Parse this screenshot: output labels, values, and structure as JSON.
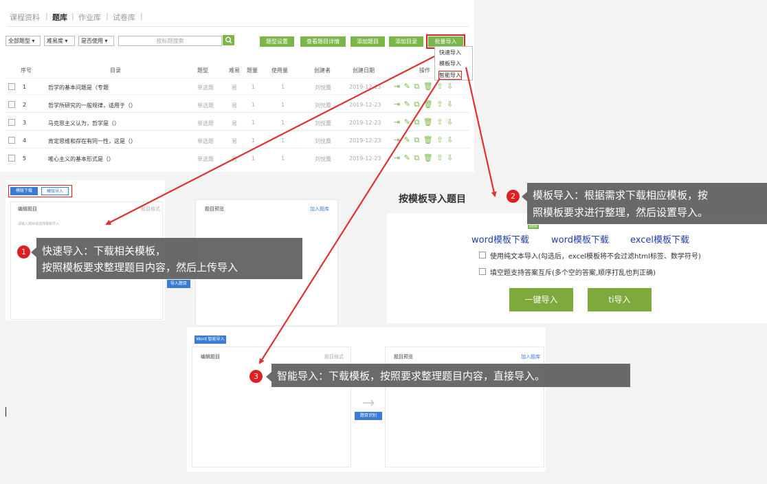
{
  "nav": {
    "tabs": [
      "课程资料",
      "题库",
      "作业库",
      "试卷库"
    ],
    "sep": "|"
  },
  "filters": {
    "type": "全部题型 ▾",
    "difficulty": "难易度 ▾",
    "used": "是否使用 ▾",
    "search_placeholder": "按标题搜索"
  },
  "toolbar": {
    "buttons": [
      "题型设置",
      "查看题目详情",
      "添加题目",
      "添加目录",
      "批量导入"
    ]
  },
  "dropdown": [
    "快速导入",
    "模板导入",
    "智能导入"
  ],
  "table": {
    "headers": [
      "序号",
      "目录",
      "题型",
      "难易",
      "题量",
      "使用量",
      "创建者",
      "创建日期",
      "操作"
    ],
    "rows": [
      {
        "no": "1",
        "title": "哲学的基本问题是（专题",
        "type": "单选题",
        "diff": "易",
        "count": "1",
        "use": "1",
        "author": "刘悦麋",
        "date": "2019-12-23"
      },
      {
        "no": "2",
        "title": "哲学所研究的一般规律，适用于（）",
        "type": "单选题",
        "diff": "易",
        "count": "1",
        "use": "1",
        "author": "刘悦麋",
        "date": "2019-12-23"
      },
      {
        "no": "3",
        "title": "马克思主义认为，哲学是（）",
        "type": "单选题",
        "diff": "易",
        "count": "1",
        "use": "1",
        "author": "刘悦麋",
        "date": "2019-12-23"
      },
      {
        "no": "4",
        "title": "肯定思维和存在有同一性，这是（）",
        "type": "单选题",
        "diff": "易",
        "count": "1",
        "use": "1",
        "author": "刘悦麋",
        "date": "2019-12-23"
      },
      {
        "no": "5",
        "title": "唯心主义的基本形式是（）",
        "type": "单选题",
        "diff": "易",
        "count": "1",
        "use": "1",
        "author": "刘悦麋",
        "date": "2019-12-23"
      }
    ],
    "ops_icons": "⇥ ✎ ⧉ 🗑 ⇧ ⇩"
  },
  "quick_panel": {
    "btn_download": "模版下载",
    "btn_import": "模版导入",
    "edit_title": "编辑题目",
    "edit_hint": "请输入题目或选择模板导入",
    "format": "题目格式",
    "preview_title": "题目预览",
    "add_bank": "加入题库",
    "import_btn": "导入题目"
  },
  "template_panel": {
    "title": "按模板导入题目",
    "links": [
      "word模板下载",
      "word模板下载",
      "excel模板下载"
    ],
    "new_badge": "NEW",
    "option1": "使用纯文本导入(勾选后，excel模板将不会过滤html标签、数学符号)",
    "option2": "填空题支持答案互斥(多个空的答案,顺序打乱也判正确)",
    "btn1": "一键导入",
    "btn2": "ti导入"
  },
  "smart_panel": {
    "btn": "Word 智能导入",
    "edit_title": "编辑题目",
    "format": "题目格式",
    "preview_title": "题目预览",
    "add_bank": "加入题库",
    "center_btn": "题目识别"
  },
  "callouts": {
    "one_num": "1",
    "one_line1": "快速导入：下载相关模板，",
    "one_line2": "按照模板要求整理题目内容，然后上传导入",
    "two_num": "2",
    "two_line1": "模板导入：根据需求下载相应模板，按",
    "two_line2": "照模板要求进行整理，然后设置导入。",
    "three_num": "3",
    "three_text": "智能导入：下载模板，按照要求整理题目内容，直接导入。"
  },
  "colors": {
    "green": "#7ab648",
    "red": "#e02020",
    "blue": "#3a7bd5"
  }
}
